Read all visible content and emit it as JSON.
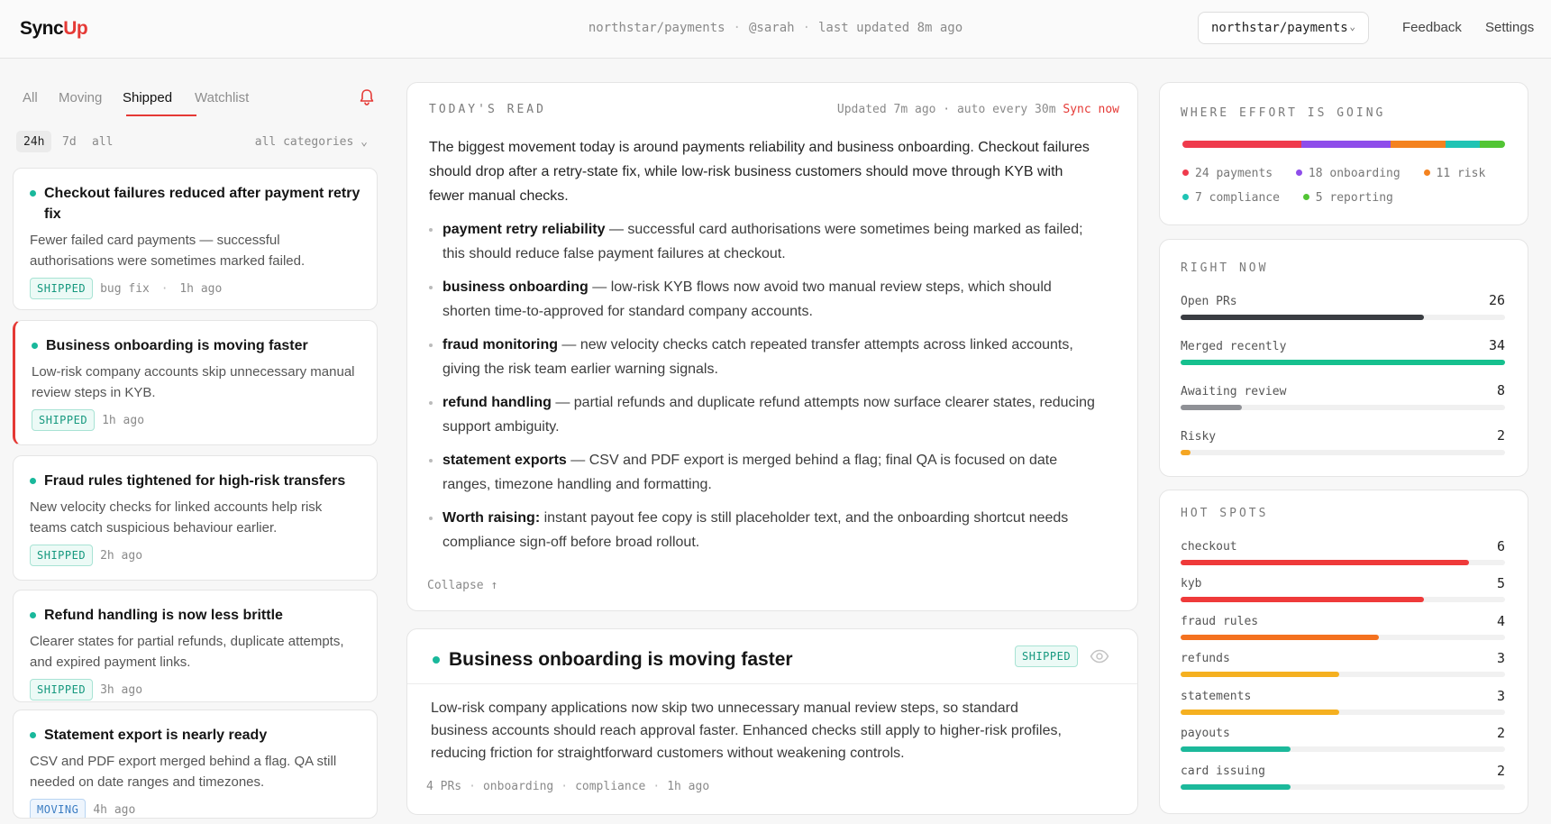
{
  "header": {
    "logo_main": "Sync",
    "logo_accent": "Up",
    "repo": "northstar/payments",
    "user": "@sarah",
    "updated": "last updated 8m ago",
    "repo_select": "northstar/payments",
    "feedback": "Feedback",
    "settings": "Settings"
  },
  "tabs": [
    "All",
    "Moving",
    "Shipped",
    "Watchlist"
  ],
  "active_tab": "Shipped",
  "filters": {
    "ranges": [
      "24h",
      "7d",
      "all"
    ],
    "active_range": "24h",
    "category": "all categories"
  },
  "cards": [
    {
      "title": "Checkout failures reduced after payment retry fix",
      "desc": "Fewer failed card payments — successful authorisations were sometimes marked failed.",
      "badge": "SHIPPED",
      "tag": "bug fix",
      "time": "1h ago"
    },
    {
      "title": "Business onboarding is moving faster",
      "desc": "Low-risk company accounts skip unnecessary manual review steps in KYB.",
      "badge": "SHIPPED",
      "tag": "",
      "time": "1h ago"
    },
    {
      "title": "Fraud rules tightened for high-risk transfers",
      "desc": "New velocity checks for linked accounts help risk teams catch suspicious behaviour earlier.",
      "badge": "SHIPPED",
      "tag": "",
      "time": "2h ago"
    },
    {
      "title": "Refund handling is now less brittle",
      "desc": "Clearer states for partial refunds, duplicate attempts, and expired payment links.",
      "badge": "SHIPPED",
      "tag": "",
      "time": "3h ago"
    },
    {
      "title": "Statement export is nearly ready",
      "desc": "CSV and PDF export merged behind a flag. QA still needed on date ranges and timezones.",
      "badge": "MOVING",
      "tag": "",
      "time": "4h ago"
    }
  ],
  "read": {
    "heading": "TODAY'S READ",
    "meta": "Updated 7m ago · auto every 30m",
    "sync": "Sync now",
    "intro": "The biggest movement today is around payments reliability and business onboarding. Checkout failures should drop after a retry-state fix, while low-risk business customers should move through KYB with fewer manual checks.",
    "bullets": [
      {
        "bold": "payment retry reliability",
        "text": " — successful card authorisations were sometimes being marked as failed; this should reduce false payment failures at checkout."
      },
      {
        "bold": "business onboarding",
        "text": " — low-risk KYB flows now avoid two manual review steps, which should shorten time-to-approved for standard company accounts."
      },
      {
        "bold": "fraud monitoring",
        "text": " — new velocity checks catch repeated transfer attempts across linked accounts, giving the risk team earlier warning signals."
      },
      {
        "bold": "refund handling",
        "text": " — partial refunds and duplicate refund attempts now surface clearer states, reducing support ambiguity."
      },
      {
        "bold": "statement exports",
        "text": " — CSV and PDF export is merged behind a flag; final QA is focused on date ranges, timezone handling and formatting."
      },
      {
        "bold": "Worth raising:",
        "text": " instant payout fee copy is still placeholder text, and the onboarding shortcut needs compliance sign-off before broad rollout."
      }
    ],
    "collapse": "Collapse ↑"
  },
  "detail": {
    "title": "Business onboarding is moving faster",
    "badge": "SHIPPED",
    "desc": "Low-risk company applications now skip two unnecessary manual review steps, so standard business accounts should reach approval faster. Enhanced checks still apply to higher-risk profiles, reducing friction for straightforward customers without weakening controls.",
    "prs": "4 PRs",
    "tag1": "onboarding",
    "tag2": "compliance",
    "time": "1h ago"
  },
  "effort": {
    "heading": "WHERE EFFORT IS GOING",
    "items": [
      {
        "label": "24 payments",
        "count": 24,
        "color": "#ef3a4c"
      },
      {
        "label": "18 onboarding",
        "count": 18,
        "color": "#8e4dea"
      },
      {
        "label": "11 risk",
        "count": 11,
        "color": "#f4821f"
      },
      {
        "label": "7 compliance",
        "count": 7,
        "color": "#1fc4b4"
      },
      {
        "label": "5 reporting",
        "count": 5,
        "color": "#52c534"
      }
    ]
  },
  "right_now": {
    "heading": "RIGHT NOW",
    "items": [
      {
        "label": "Open PRs",
        "value": "26",
        "fraction": 0.75,
        "color": "#3a3d42"
      },
      {
        "label": "Merged recently",
        "value": "34",
        "fraction": 1.0,
        "color": "#16c08e"
      },
      {
        "label": "Awaiting review",
        "value": "8",
        "fraction": 0.19,
        "color": "#8f9196"
      },
      {
        "label": "Risky",
        "value": "2",
        "fraction": 0.03,
        "color": "#f5a623"
      }
    ]
  },
  "hot_spots": {
    "heading": "HOT SPOTS",
    "items": [
      {
        "label": "checkout",
        "value": "6",
        "fraction": 0.89,
        "color": "#ef3a3a"
      },
      {
        "label": "kyb",
        "value": "5",
        "fraction": 0.75,
        "color": "#ef3a3a"
      },
      {
        "label": "fraud rules",
        "value": "4",
        "fraction": 0.61,
        "color": "#f4711f"
      },
      {
        "label": "refunds",
        "value": "3",
        "fraction": 0.49,
        "color": "#f5b020"
      },
      {
        "label": "statements",
        "value": "3",
        "fraction": 0.49,
        "color": "#f5b020"
      },
      {
        "label": "payouts",
        "value": "2",
        "fraction": 0.34,
        "color": "#1cb99b"
      },
      {
        "label": "card issuing",
        "value": "2",
        "fraction": 0.34,
        "color": "#1cb99b"
      }
    ]
  }
}
